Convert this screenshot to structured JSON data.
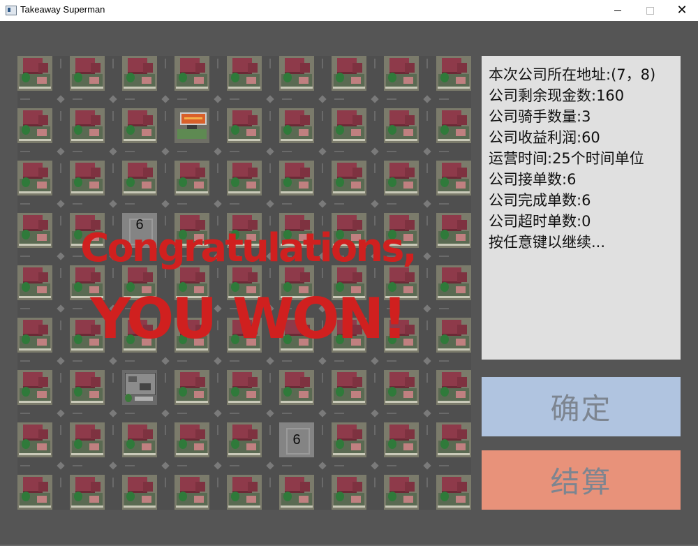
{
  "window": {
    "title": "Takeaway Superman",
    "minimize_glyph": "minimize-icon",
    "maximize_glyph": "maximize-icon",
    "close_label": "✕"
  },
  "board": {
    "rows": 9,
    "cols": 9,
    "special_cells": [
      {
        "row": 1,
        "col": 3,
        "kind": "shop"
      },
      {
        "row": 3,
        "col": 2,
        "kind": "pending",
        "number": "6"
      },
      {
        "row": 6,
        "col": 2,
        "kind": "office"
      },
      {
        "row": 7,
        "col": 5,
        "kind": "pending",
        "number": "6"
      }
    ]
  },
  "overlay": {
    "line1": "Congratulations,",
    "line2": "YOU WON!"
  },
  "info": {
    "lines": [
      "本次公司所在地址:(7，8)",
      "公司剩余现金数:160",
      "公司骑手数量:3",
      "公司收益利润:60",
      "运营时间:25个时间单位",
      "公司接单数:6",
      "公司完成单数:6",
      "公司超时单数:0",
      "按任意键以继续..."
    ]
  },
  "buttons": {
    "ok_label": "确定",
    "settle_label": "结算"
  },
  "colors": {
    "overlay_text": "#d0201f",
    "ok_button": "#b0c4e0",
    "settle_button": "#e8927a"
  }
}
